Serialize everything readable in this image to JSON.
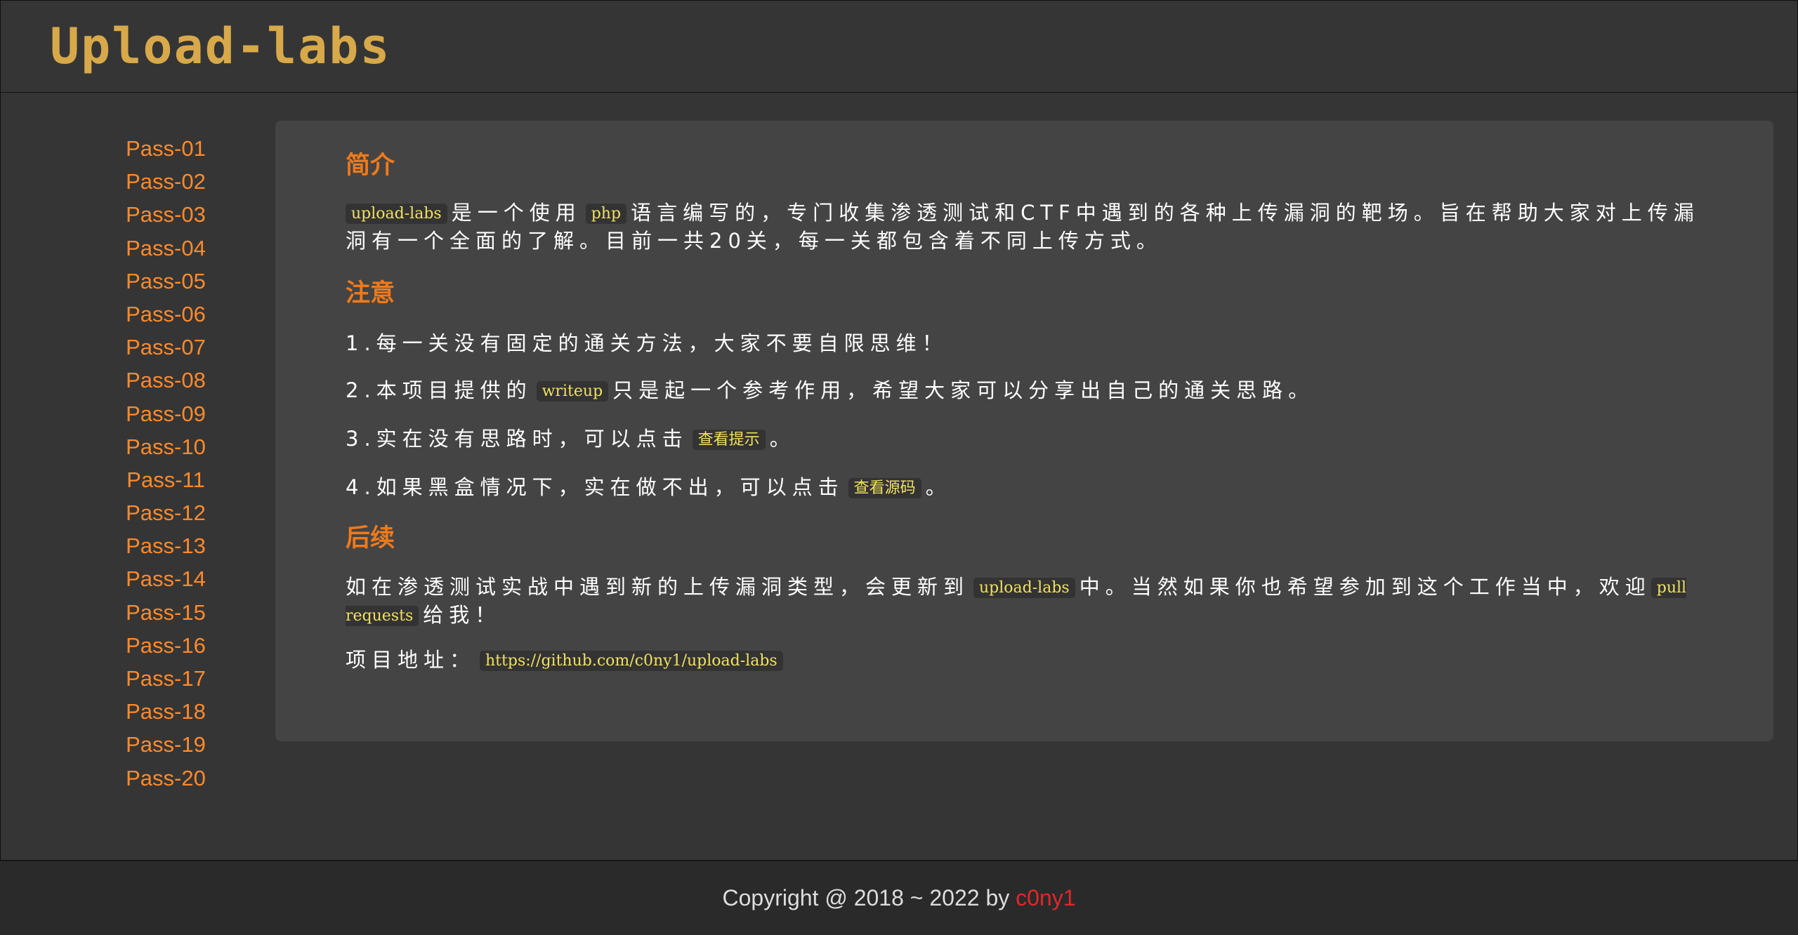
{
  "header": {
    "logo_text": "Upload-labs"
  },
  "sidebar": {
    "items": [
      {
        "label": "Pass-01"
      },
      {
        "label": "Pass-02"
      },
      {
        "label": "Pass-03"
      },
      {
        "label": "Pass-04"
      },
      {
        "label": "Pass-05"
      },
      {
        "label": "Pass-06"
      },
      {
        "label": "Pass-07"
      },
      {
        "label": "Pass-08"
      },
      {
        "label": "Pass-09"
      },
      {
        "label": "Pass-10"
      },
      {
        "label": "Pass-11"
      },
      {
        "label": "Pass-12"
      },
      {
        "label": "Pass-13"
      },
      {
        "label": "Pass-14"
      },
      {
        "label": "Pass-15"
      },
      {
        "label": "Pass-16"
      },
      {
        "label": "Pass-17"
      },
      {
        "label": "Pass-18"
      },
      {
        "label": "Pass-19"
      },
      {
        "label": "Pass-20"
      }
    ]
  },
  "content": {
    "intro": {
      "heading": "简介",
      "code1": "upload-labs",
      "text1": "是一个使用",
      "code2": "php",
      "text2": "语言编写的，专门收集渗透测试和CTF中遇到的各种上传漏洞的靶场。旨在帮助大家对上传漏洞有一个全面的了解。目前一共20关，每一关都包含着不同上传方式。"
    },
    "notes": {
      "heading": "注意",
      "n1": "1.每一关没有固定的通关方法，大家不要自限思维！",
      "n2_prefix": "2.本项目提供的",
      "n2_code": "writeup",
      "n2_suffix": "只是起一个参考作用，希望大家可以分享出自己的通关思路。",
      "n3_prefix": "3.实在没有思路时，可以点击",
      "n3_code": "查看提示",
      "n3_suffix": "。",
      "n4_prefix": "4.如果黑盒情况下，实在做不出，可以点击",
      "n4_code": "查看源码",
      "n4_suffix": "。"
    },
    "followup": {
      "heading": "后续",
      "t1": "如在渗透测试实战中遇到新的上传漏洞类型，会更新到",
      "code1": "upload-labs",
      "t2": "中。当然如果你也希望参加到这个工作当中，欢迎",
      "code2": "pull requests",
      "t3": "给我！",
      "addr_label": "项目地址：",
      "addr_url": "https://github.com/c0ny1/upload-labs"
    }
  },
  "footer": {
    "copyright": "Copyright @ 2018 ~ 2022 by ",
    "author": "c0ny1"
  }
}
